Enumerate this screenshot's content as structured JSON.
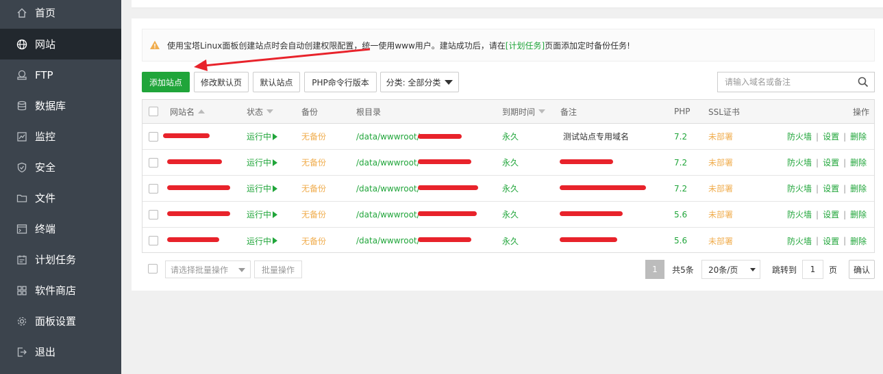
{
  "sidebar": {
    "items": [
      {
        "label": "首页",
        "icon": "home-icon"
      },
      {
        "label": "网站",
        "icon": "globe-icon",
        "active": true
      },
      {
        "label": "FTP",
        "icon": "ftp-icon"
      },
      {
        "label": "数据库",
        "icon": "database-icon"
      },
      {
        "label": "监控",
        "icon": "monitor-icon"
      },
      {
        "label": "安全",
        "icon": "shield-icon"
      },
      {
        "label": "文件",
        "icon": "folder-icon"
      },
      {
        "label": "终端",
        "icon": "terminal-icon"
      },
      {
        "label": "计划任务",
        "icon": "calendar-icon"
      },
      {
        "label": "软件商店",
        "icon": "grid-icon"
      },
      {
        "label": "面板设置",
        "icon": "gear-icon"
      },
      {
        "label": "退出",
        "icon": "logout-icon"
      }
    ]
  },
  "notice": {
    "text_before": "使用宝塔Linux面板创建站点时会自动创建权限配置，统一使用www用户。建站成功后，请在",
    "link": "[计划任务]",
    "text_after": "页面添加定时备份任务!"
  },
  "toolbar": {
    "add_site": "添加站点",
    "edit_default_page": "修改默认页",
    "default_site": "默认站点",
    "php_cli_version": "PHP命令行版本",
    "category": "分类: 全部分类"
  },
  "search": {
    "placeholder": "请输入域名或备注"
  },
  "table": {
    "headers": {
      "name": "网站名",
      "status": "状态",
      "backup": "备份",
      "root": "根目录",
      "expire": "到期时间",
      "remark": "备注",
      "php": "PHP",
      "ssl": "SSL证书",
      "actions": "操作"
    },
    "rows": [
      {
        "name": "",
        "status": "运行中",
        "backup": "无备份",
        "root": "/data/wwwroot/",
        "expire": "永久",
        "remark": "测试站点专用域名",
        "php": "7.2",
        "ssl": "未部署",
        "a1": "防火墙",
        "a2": "设置",
        "a3": "删除"
      },
      {
        "name": "",
        "status": "运行中",
        "backup": "无备份",
        "root": "/data/wwwroot/",
        "expire": "永久",
        "remark": "",
        "php": "7.2",
        "ssl": "未部署",
        "a1": "防火墙",
        "a2": "设置",
        "a3": "删除"
      },
      {
        "name": "",
        "status": "运行中",
        "backup": "无备份",
        "root": "/data/wwwroot/",
        "expire": "永久",
        "remark": "",
        "php": "7.2",
        "ssl": "未部署",
        "a1": "防火墙",
        "a2": "设置",
        "a3": "删除"
      },
      {
        "name": "",
        "status": "运行中",
        "backup": "无备份",
        "root": "/data/wwwroot/",
        "expire": "永久",
        "remark": "",
        "php": "5.6",
        "ssl": "未部署",
        "a1": "防火墙",
        "a2": "设置",
        "a3": "删除"
      },
      {
        "name": "",
        "status": "运行中",
        "backup": "无备份",
        "root": "/data/wwwroot/",
        "expire": "永久",
        "remark": "",
        "php": "5.6",
        "ssl": "未部署",
        "a1": "防火墙",
        "a2": "设置",
        "a3": "删除"
      }
    ]
  },
  "footer": {
    "batch_select_placeholder": "请选择批量操作",
    "batch_button": "批量操作",
    "page_current": "1",
    "total": "共5条",
    "per_page": "20条/页",
    "jump_label": "跳转到",
    "jump_value": "1",
    "page_unit": "页",
    "confirm": "确认"
  },
  "colors": {
    "accent": "#20a53a",
    "warning": "#f0ad4e",
    "sidebar_bg": "#3c444d",
    "redaction": "#e8232b"
  }
}
